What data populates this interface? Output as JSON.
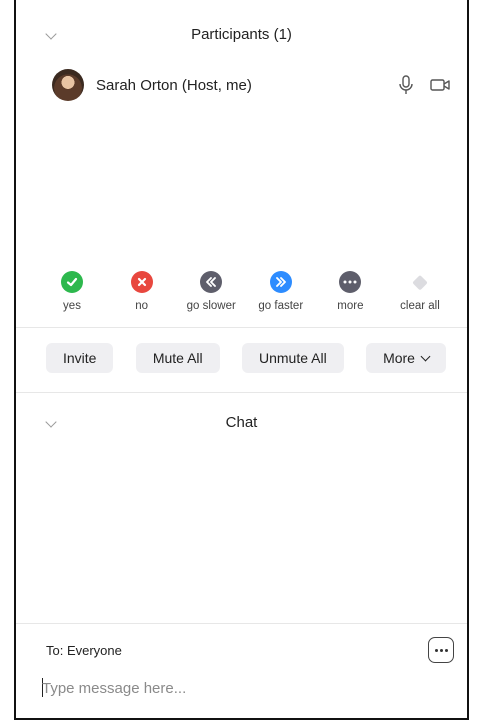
{
  "participants_panel": {
    "title": "Participants (1)",
    "participant": {
      "name": "Sarah Orton (Host, me)"
    }
  },
  "reactions": [
    {
      "label": "yes",
      "color": "#2db84d",
      "icon": "check-icon"
    },
    {
      "label": "no",
      "color": "#e8473e",
      "icon": "x-icon"
    },
    {
      "label": "go slower",
      "color": "#5e5e6b",
      "icon": "double-chevron-left-icon"
    },
    {
      "label": "go faster",
      "color": "#2d8cff",
      "icon": "double-chevron-right-icon"
    },
    {
      "label": "more",
      "color": "#5e5e6b",
      "icon": "ellipsis-icon"
    },
    {
      "label": "clear all",
      "color": "#cfcfd4",
      "icon": "eraser-icon"
    }
  ],
  "actions": {
    "invite": "Invite",
    "mute_all": "Mute All",
    "unmute_all": "Unmute All",
    "more": "More"
  },
  "chat_panel": {
    "title": "Chat",
    "to_label": "To: Everyone",
    "placeholder": "Type message here..."
  }
}
